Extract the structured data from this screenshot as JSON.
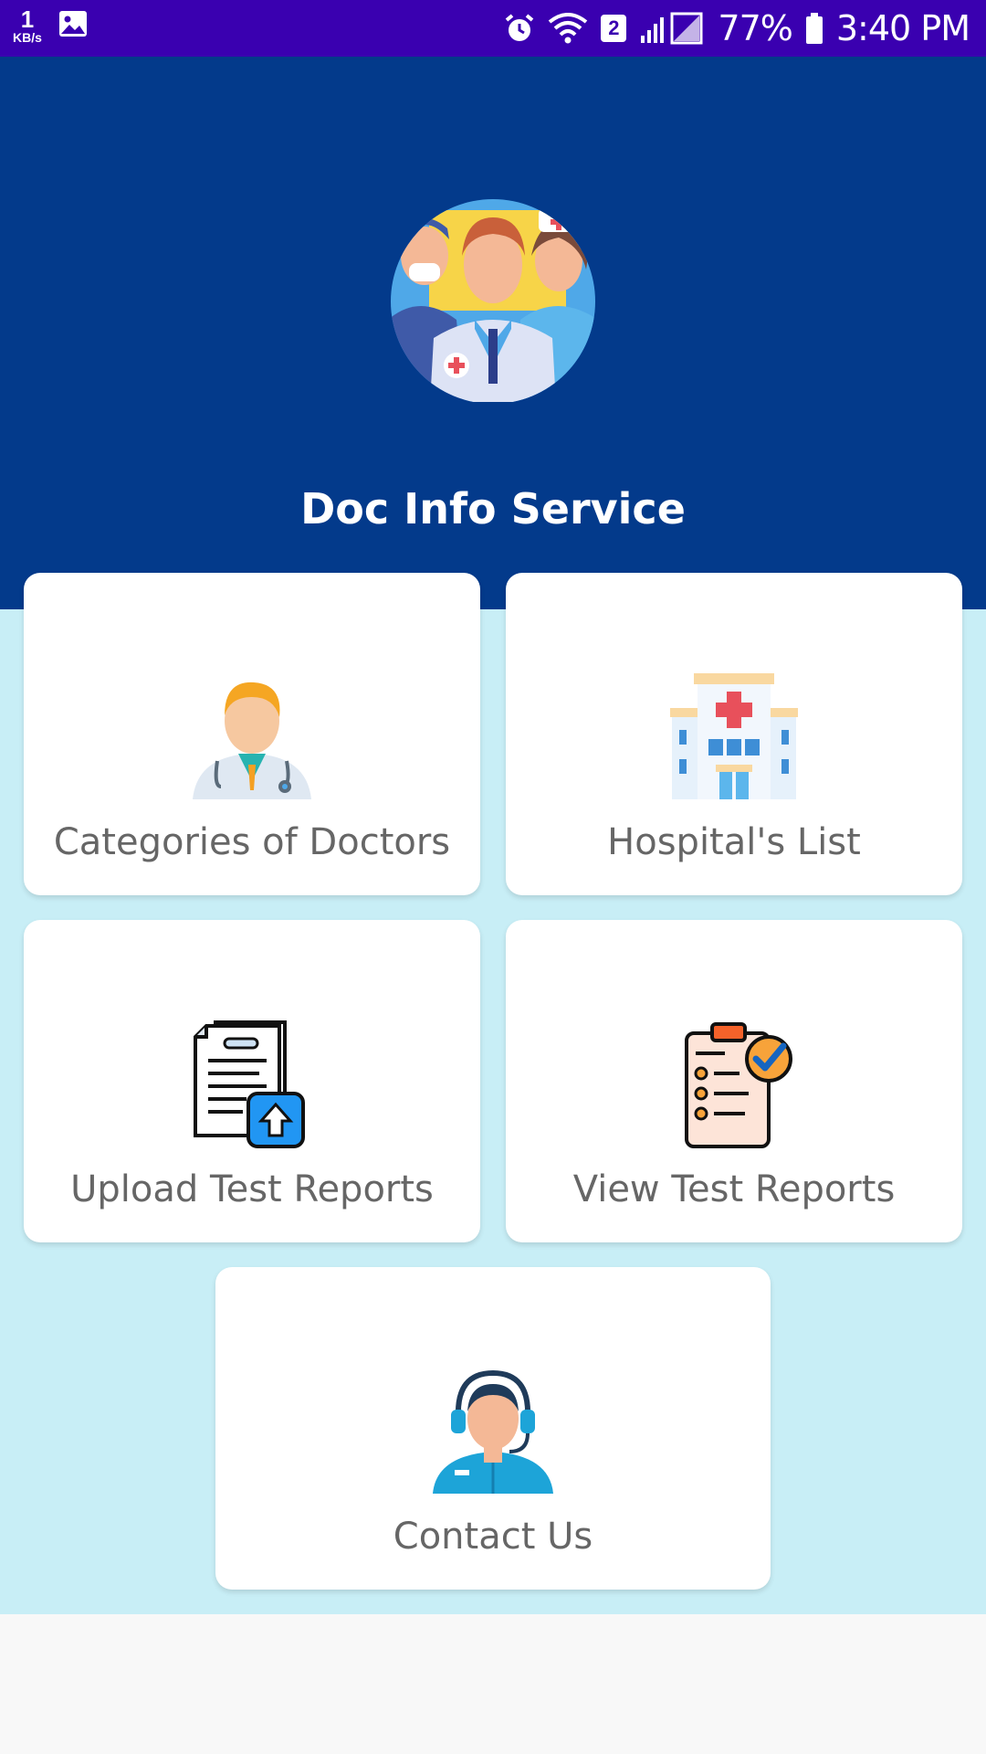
{
  "status_bar": {
    "net_speed_value": "1",
    "net_speed_unit": "KB/s",
    "sim_slot": "2",
    "battery": "77%",
    "time": "3:40 PM",
    "icons": [
      "gallery-icon",
      "alarm-icon",
      "wifi-icon",
      "signal-icon",
      "battery-icon"
    ]
  },
  "header": {
    "title": "Doc Info Service",
    "background_color": "#033a8b",
    "logo_icon": "doctors-group-icon"
  },
  "menu": {
    "categories": {
      "label": "Categories of Doctors",
      "icon": "doctor-icon"
    },
    "hospitals": {
      "label": "Hospital's List",
      "icon": "hospital-icon"
    },
    "upload": {
      "label": "Upload Test Reports",
      "icon": "upload-report-icon"
    },
    "view": {
      "label": "View Test Reports",
      "icon": "clipboard-check-icon"
    },
    "contact": {
      "label": "Contact Us",
      "icon": "support-agent-icon"
    }
  },
  "colors": {
    "status_bar": "#3a00b0",
    "main_background": "#c8eef6",
    "card_text": "#666666"
  }
}
